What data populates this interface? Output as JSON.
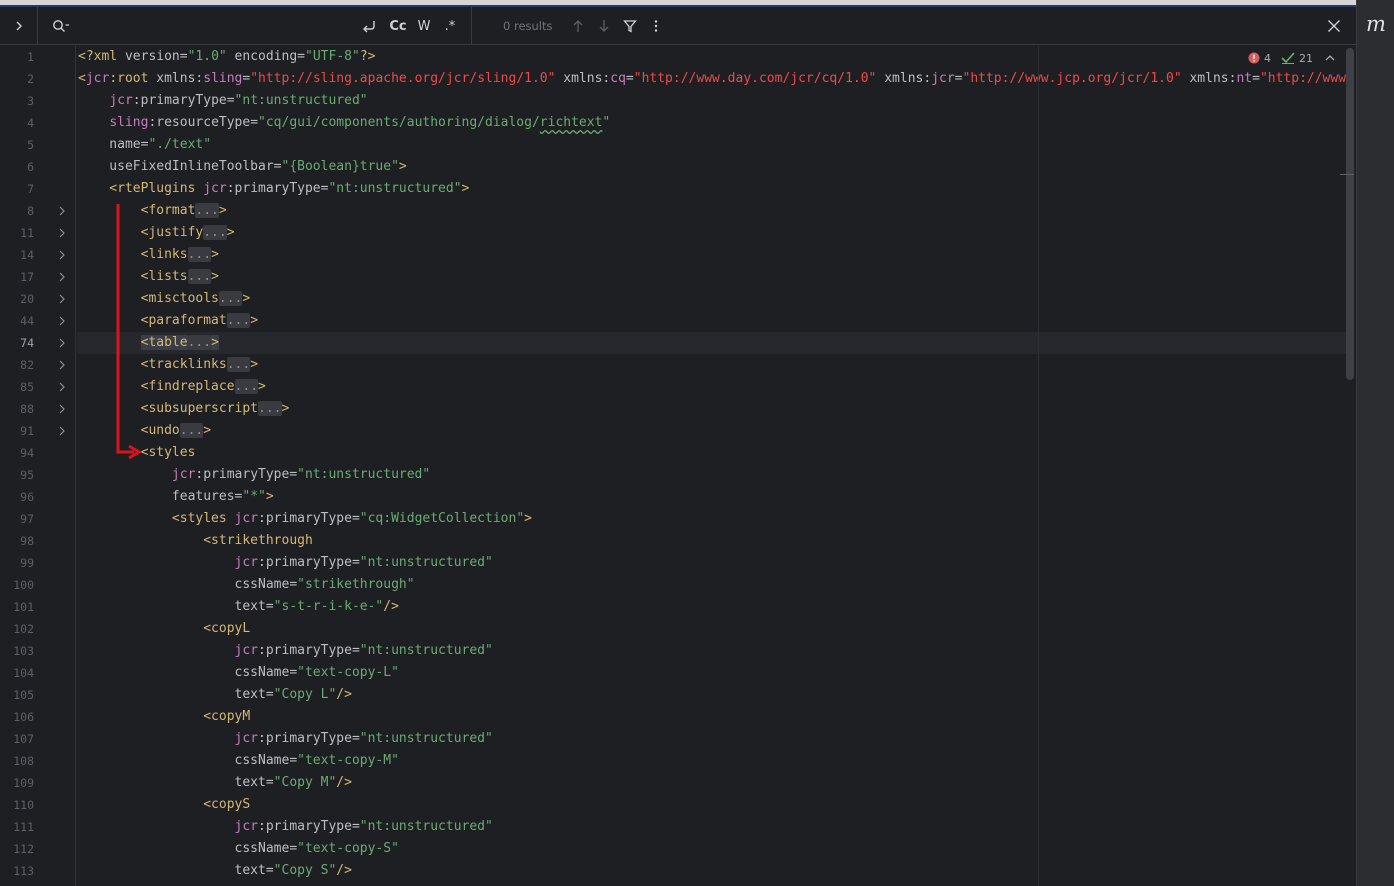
{
  "search": {
    "placeholder": "",
    "match_case_label": "Cc",
    "words_label": "W",
    "regex_label": ".*",
    "results": "0 results"
  },
  "inspections": {
    "errors": "4",
    "checks": "21"
  },
  "side_logo": "m",
  "annotation_color": "#d9141c",
  "colors": {
    "tag": "#d5b778",
    "namespace": "#c77dbb",
    "value": "#6aab73",
    "url": "#ed4a4a"
  },
  "editor": {
    "current_line": "74",
    "lines": [
      {
        "n": "1",
        "fold": false,
        "segs": [
          [
            "t",
            "<?xml "
          ],
          [
            "a",
            "version="
          ],
          [
            "v",
            "\"1.0\""
          ],
          [
            "a",
            " encoding="
          ],
          [
            "v",
            "\"UTF-8\""
          ],
          [
            "t",
            "?>"
          ]
        ]
      },
      {
        "n": "2",
        "fold": false,
        "segs": [
          [
            "t",
            "<"
          ],
          [
            "ns",
            "jcr"
          ],
          [
            "t",
            ":root "
          ],
          [
            "a",
            "xmlns:"
          ],
          [
            "ns",
            "sling"
          ],
          [
            "a",
            "="
          ],
          [
            "u",
            "\"http://sling.apache.org/jcr/sling/1.0\""
          ],
          [
            "a",
            " xmlns:"
          ],
          [
            "ns",
            "cq"
          ],
          [
            "a",
            "="
          ],
          [
            "u",
            "\"http://www.day.com/jcr/cq/1.0\""
          ],
          [
            "a",
            " xmlns:"
          ],
          [
            "ns",
            "jcr"
          ],
          [
            "a",
            "="
          ],
          [
            "u",
            "\"http://www.jcp.org/jcr/1.0\""
          ],
          [
            "a",
            " xmlns:"
          ],
          [
            "ns",
            "nt"
          ],
          [
            "a",
            "="
          ],
          [
            "u",
            "\"http://www"
          ]
        ]
      },
      {
        "n": "3",
        "fold": false,
        "segs": [
          [
            "a",
            "    "
          ],
          [
            "ns",
            "jcr"
          ],
          [
            "a",
            ":primaryType="
          ],
          [
            "v",
            "\"nt:unstructured\""
          ]
        ]
      },
      {
        "n": "4",
        "fold": false,
        "segs": [
          [
            "a",
            "    "
          ],
          [
            "ns",
            "sling"
          ],
          [
            "a",
            ":resourceType="
          ],
          [
            "v",
            "\"cq/gui/components/authoring/dialog/"
          ],
          [
            "vw",
            "richtext"
          ],
          [
            "v",
            "\""
          ]
        ]
      },
      {
        "n": "5",
        "fold": false,
        "segs": [
          [
            "a",
            "    name="
          ],
          [
            "v",
            "\"./text\""
          ]
        ]
      },
      {
        "n": "6",
        "fold": false,
        "segs": [
          [
            "a",
            "    useFixedInlineToolbar="
          ],
          [
            "v",
            "\"{Boolean}true\""
          ],
          [
            "t",
            ">"
          ]
        ]
      },
      {
        "n": "7",
        "fold": false,
        "segs": [
          [
            "t",
            "    <rtePlugins "
          ],
          [
            "ns",
            "jcr"
          ],
          [
            "a",
            ":primaryType="
          ],
          [
            "v",
            "\"nt:unstructured\""
          ],
          [
            "t",
            ">"
          ]
        ]
      },
      {
        "n": "8",
        "fold": true,
        "segs": [
          [
            "t",
            "        <format"
          ],
          [
            "p",
            "..."
          ],
          [
            "t",
            ">"
          ]
        ]
      },
      {
        "n": "11",
        "fold": true,
        "segs": [
          [
            "t",
            "        <justify"
          ],
          [
            "p",
            "..."
          ],
          [
            "t",
            ">"
          ]
        ]
      },
      {
        "n": "14",
        "fold": true,
        "segs": [
          [
            "t",
            "        <links"
          ],
          [
            "p",
            "..."
          ],
          [
            "t",
            ">"
          ]
        ]
      },
      {
        "n": "17",
        "fold": true,
        "segs": [
          [
            "t",
            "        <lists"
          ],
          [
            "p",
            "..."
          ],
          [
            "t",
            ">"
          ]
        ]
      },
      {
        "n": "20",
        "fold": true,
        "segs": [
          [
            "t",
            "        <misctools"
          ],
          [
            "p",
            "..."
          ],
          [
            "t",
            ">"
          ]
        ]
      },
      {
        "n": "44",
        "fold": true,
        "segs": [
          [
            "t",
            "        <paraformat"
          ],
          [
            "p",
            "..."
          ],
          [
            "t",
            ">"
          ]
        ]
      },
      {
        "n": "74",
        "fold": true,
        "bulb": true,
        "segs": [
          [
            "a",
            "        "
          ],
          [
            "th",
            "<table"
          ],
          [
            "p",
            "..."
          ],
          [
            "th",
            ">"
          ]
        ]
      },
      {
        "n": "82",
        "fold": true,
        "segs": [
          [
            "t",
            "        <tracklinks"
          ],
          [
            "p",
            "..."
          ],
          [
            "t",
            ">"
          ]
        ]
      },
      {
        "n": "85",
        "fold": true,
        "segs": [
          [
            "t",
            "        <findreplace"
          ],
          [
            "p",
            "..."
          ],
          [
            "t",
            ">"
          ]
        ]
      },
      {
        "n": "88",
        "fold": true,
        "segs": [
          [
            "t",
            "        <subsuperscript"
          ],
          [
            "p",
            "..."
          ],
          [
            "t",
            ">"
          ]
        ]
      },
      {
        "n": "91",
        "fold": true,
        "segs": [
          [
            "t",
            "        <undo"
          ],
          [
            "p",
            "..."
          ],
          [
            "t",
            ">"
          ]
        ]
      },
      {
        "n": "94",
        "fold": false,
        "segs": [
          [
            "t",
            "        <styles"
          ]
        ]
      },
      {
        "n": "95",
        "fold": false,
        "segs": [
          [
            "a",
            "            "
          ],
          [
            "ns",
            "jcr"
          ],
          [
            "a",
            ":primaryType="
          ],
          [
            "v",
            "\"nt:unstructured\""
          ]
        ]
      },
      {
        "n": "96",
        "fold": false,
        "segs": [
          [
            "a",
            "            features="
          ],
          [
            "v",
            "\"*\""
          ],
          [
            "t",
            ">"
          ]
        ]
      },
      {
        "n": "97",
        "fold": false,
        "segs": [
          [
            "t",
            "            <styles "
          ],
          [
            "ns",
            "jcr"
          ],
          [
            "a",
            ":primaryType="
          ],
          [
            "v",
            "\"cq:WidgetCollection\""
          ],
          [
            "t",
            ">"
          ]
        ]
      },
      {
        "n": "98",
        "fold": false,
        "segs": [
          [
            "t",
            "                <strikethrough"
          ]
        ]
      },
      {
        "n": "99",
        "fold": false,
        "segs": [
          [
            "a",
            "                    "
          ],
          [
            "ns",
            "jcr"
          ],
          [
            "a",
            ":primaryType="
          ],
          [
            "v",
            "\"nt:unstructured\""
          ]
        ]
      },
      {
        "n": "100",
        "fold": false,
        "segs": [
          [
            "a",
            "                    cssName="
          ],
          [
            "v",
            "\"strikethrough\""
          ]
        ]
      },
      {
        "n": "101",
        "fold": false,
        "segs": [
          [
            "a",
            "                    text="
          ],
          [
            "v",
            "\"s-t-r-i-k-e-\""
          ],
          [
            "t",
            "/>"
          ]
        ]
      },
      {
        "n": "102",
        "fold": false,
        "segs": [
          [
            "t",
            "                <copyL"
          ]
        ]
      },
      {
        "n": "103",
        "fold": false,
        "segs": [
          [
            "a",
            "                    "
          ],
          [
            "ns",
            "jcr"
          ],
          [
            "a",
            ":primaryType="
          ],
          [
            "v",
            "\"nt:unstructured\""
          ]
        ]
      },
      {
        "n": "104",
        "fold": false,
        "segs": [
          [
            "a",
            "                    cssName="
          ],
          [
            "v",
            "\"text-copy-L\""
          ]
        ]
      },
      {
        "n": "105",
        "fold": false,
        "segs": [
          [
            "a",
            "                    text="
          ],
          [
            "v",
            "\"Copy L\""
          ],
          [
            "t",
            "/>"
          ]
        ]
      },
      {
        "n": "106",
        "fold": false,
        "segs": [
          [
            "t",
            "                <copyM"
          ]
        ]
      },
      {
        "n": "107",
        "fold": false,
        "segs": [
          [
            "a",
            "                    "
          ],
          [
            "ns",
            "jcr"
          ],
          [
            "a",
            ":primaryType="
          ],
          [
            "v",
            "\"nt:unstructured\""
          ]
        ]
      },
      {
        "n": "108",
        "fold": false,
        "segs": [
          [
            "a",
            "                    cssName="
          ],
          [
            "v",
            "\"text-copy-M\""
          ]
        ]
      },
      {
        "n": "109",
        "fold": false,
        "segs": [
          [
            "a",
            "                    text="
          ],
          [
            "v",
            "\"Copy M\""
          ],
          [
            "t",
            "/>"
          ]
        ]
      },
      {
        "n": "110",
        "fold": false,
        "segs": [
          [
            "t",
            "                <copyS"
          ]
        ]
      },
      {
        "n": "111",
        "fold": false,
        "segs": [
          [
            "a",
            "                    "
          ],
          [
            "ns",
            "jcr"
          ],
          [
            "a",
            ":primaryType="
          ],
          [
            "v",
            "\"nt:unstructured\""
          ]
        ]
      },
      {
        "n": "112",
        "fold": false,
        "segs": [
          [
            "a",
            "                    cssName="
          ],
          [
            "v",
            "\"text-copy-S\""
          ]
        ]
      },
      {
        "n": "113",
        "fold": false,
        "segs": [
          [
            "a",
            "                    text="
          ],
          [
            "v",
            "\"Copy S\""
          ],
          [
            "t",
            "/>"
          ]
        ]
      }
    ]
  }
}
